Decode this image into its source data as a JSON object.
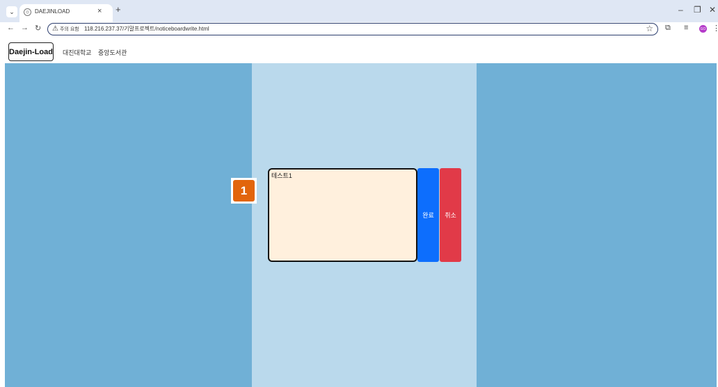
{
  "browser": {
    "tab_title": "DAEJINLOAD",
    "new_tab_label": "+",
    "tab_close_label": "×",
    "address": {
      "warning_text": "주의 요함",
      "url": "118.216.237.37/기말프로젝트/noticeboardwrite.html"
    },
    "profile_initials": "GO",
    "window_controls": {
      "minimize": "–",
      "restore": "❐",
      "close": "✕"
    }
  },
  "site": {
    "logo_text": "Daejin-Load",
    "nav_links": [
      "대진대학교",
      "중앙도서관"
    ]
  },
  "editor": {
    "annotation_number": "1",
    "textarea_value": "테스트1",
    "done_label": "완료",
    "cancel_label": "취소"
  },
  "colors": {
    "page_bg": "#70b0d6",
    "center_bg": "#bad9ec",
    "textarea_bg": "#fff0dd",
    "done_bg": "#0d6efd",
    "cancel_bg": "#e13a48",
    "badge_bg": "#e2650c"
  },
  "icons": {
    "tab_dropdown": "chevron-down-icon",
    "favicon": "globe-icon",
    "back": "back-arrow-icon",
    "forward": "forward-arrow-icon",
    "reload": "reload-icon",
    "warning": "warning-icon",
    "bookmark": "star-icon",
    "extensions": "puzzle-icon",
    "reading_list": "reading-list-icon",
    "menu": "kebab-menu-icon"
  }
}
